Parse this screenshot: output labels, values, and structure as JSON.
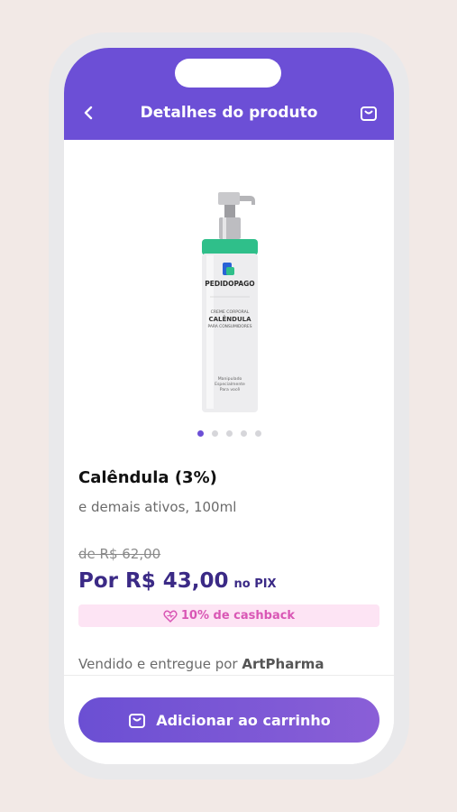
{
  "header": {
    "title": "Detalhes do produto",
    "back_icon": "chevron-left-icon",
    "cart_icon": "shopping-bag-icon"
  },
  "product": {
    "brand": "PEDIDOPAGO",
    "label_line1": "CREME CORPORAL",
    "label_line2": "CALÊNDULA",
    "label_line3": "PARA CONSUMIDORES",
    "label_line4": "Manipulado",
    "label_line5": "Especialmente",
    "label_line6": "Para você",
    "name": "Calêndula (3%)",
    "subtitle": "e demais ativos, 100ml",
    "image_count": 5,
    "active_image_index": 0
  },
  "pricing": {
    "old_price": "de R$ 62,00",
    "price": "Por R$ 43,00",
    "price_suffix": "no PIX",
    "cashback": "10% de cashback",
    "cashback_icon": "heart-icon"
  },
  "seller": {
    "prefix": "Vendido e entregue por",
    "name": "ArtPharma"
  },
  "cta": {
    "label": "Adicionar ao carrinho",
    "icon": "shopping-bag-icon"
  },
  "colors": {
    "primary": "#6c4fd6",
    "price": "#3b2a86",
    "cashback_bg": "#fde4f4",
    "cashback_text": "#d957b5",
    "bottle_cap": "#2fbf8a"
  }
}
